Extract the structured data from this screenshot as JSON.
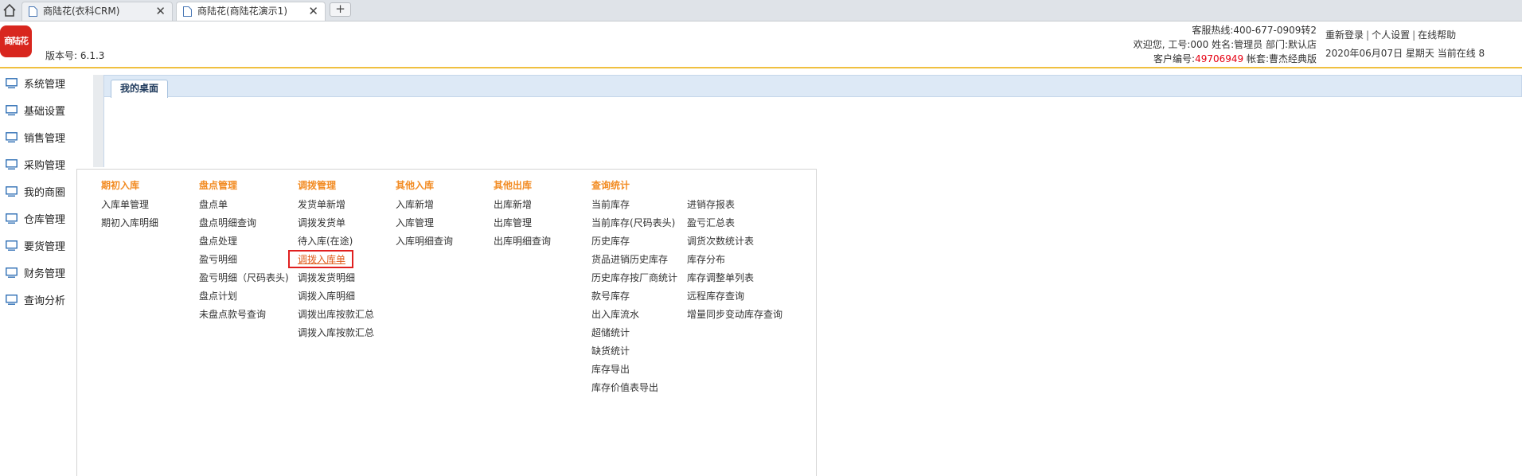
{
  "browser_tabs": [
    {
      "label": "商陆花(衣科CRM)",
      "active": false
    },
    {
      "label": "商陆花(商陆花演示1)",
      "active": true
    }
  ],
  "new_tab_label": "+",
  "close_glyph": "✕",
  "logo_text": "商陆花",
  "version": {
    "label": "版本号:",
    "value": "6.1.3"
  },
  "header_info": {
    "hotline": "客服热线:400-677-0909转2",
    "welcome": "欢迎您,  工号:000 姓名:管理员 部门:默认店",
    "customer_no_label": "客户编号:",
    "customer_no": "49706949",
    "account": " 帐套:曹杰经典版"
  },
  "header_links": [
    "重新登录",
    "个人设置",
    "在线帮助"
  ],
  "date_line": "2020年06月07日 星期天 当前在线 8",
  "sidebar": [
    "系统管理",
    "基础设置",
    "销售管理",
    "采购管理",
    "我的商圈",
    "仓库管理",
    "要货管理",
    "财务管理",
    "查询分析"
  ],
  "main_tab": "我的桌面",
  "menu": {
    "columns": [
      {
        "title": "期初入库",
        "items": [
          "入库单管理",
          "期初入库明细"
        ]
      },
      {
        "title": "盘点管理",
        "items": [
          "盘点单",
          "盘点明细查询",
          "盘点处理",
          "盈亏明细",
          "盈亏明细（尺码表头)",
          "盘点计划",
          "未盘点款号查询"
        ]
      },
      {
        "title": "调拨管理",
        "items": [
          "发货单新增",
          "调拨发货单",
          "待入库(在途)",
          "调拨入库单",
          "调拨发货明细",
          "调拨入库明细",
          "调拨出库按款汇总",
          "调拨入库按款汇总"
        ]
      },
      {
        "title": "其他入库",
        "items": [
          "入库新增",
          "入库管理",
          "入库明细查询"
        ]
      },
      {
        "title": "其他出库",
        "items": [
          "出库新增",
          "出库管理",
          "出库明细查询"
        ]
      },
      {
        "title": "查询统计",
        "items": [
          "当前库存",
          "当前库存(尺码表头)",
          "历史库存",
          "货品进销历史库存",
          "历史库存按厂商统计",
          "款号库存",
          "出入库流水",
          "超储统计",
          "缺货统计",
          "库存导出",
          "库存价值表导出"
        ]
      },
      {
        "title": "",
        "items": [
          "进销存报表",
          "盈亏汇总表",
          "调货次数统计表",
          "库存分布",
          "库存调整单列表",
          "远程库存查询",
          "增量同步变动库存查询"
        ]
      }
    ],
    "highlighted": "调拨入库单"
  },
  "colors": {
    "header_border": "#f0c040",
    "menu_heading": "#f28b22",
    "highlight_border": "#e02020",
    "logo_bg": "#d8261e",
    "accent_red": "#e60012"
  },
  "icons": [
    "home-icon",
    "page-icon",
    "monitor-icon",
    "close-icon"
  ]
}
